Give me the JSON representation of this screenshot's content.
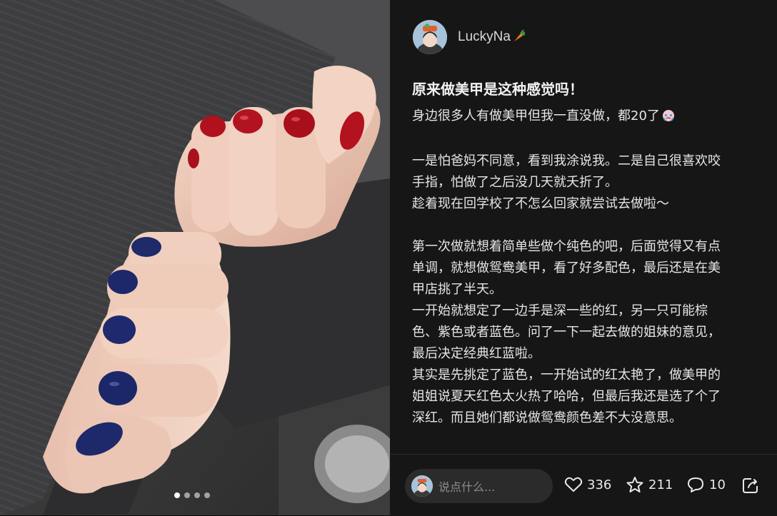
{
  "author": {
    "name": "LuckyNa",
    "name_suffix_icon": "carrot-emoji"
  },
  "post": {
    "title": "原来做美甲是这种感觉吗！",
    "lines": [
      "身边很多人有做美甲但我一直没做，都20了",
      "",
      "一是怕爸妈不同意，看到我涂说我。二是自己很喜欢咬",
      "手指，怕做了之后没几天就夭折了。",
      "趁着现在回学校了不怎么回家就尝试去做啦～",
      "",
      "第一次做就想着简单些做个纯色的吧，后面觉得又有点",
      "单调，就想做鸳鸯美甲，看了好多配色，最后还是在美",
      "甲店挑了半天。",
      "一开始就想定了一边手是深一些的红，另一只可能棕",
      "色、紫色或者蓝色。问了一下一起去做的姐妹的意见，",
      "最后决定经典红蓝啦。",
      "其实是先挑定了蓝色，一开始试的红太艳了，做美甲的",
      "姐姐说夏天红色太火热了哈哈，但最后我还是选了个了",
      "深红。而且她们都说做鸳鸯颜色差不大没意思。"
    ],
    "inline_emoji": "crying-face-emoji"
  },
  "gallery": {
    "total_images": 4,
    "current_index": 0
  },
  "bottom_bar": {
    "comment_placeholder": "说点什么...",
    "likes": "336",
    "stars": "211",
    "comments": "10",
    "icons": [
      "heart-icon",
      "star-icon",
      "comment-icon",
      "share-icon"
    ]
  },
  "colors": {
    "panel_bg": "#161616",
    "text": "#e6e6e6",
    "red_nail": "#b0111c",
    "blue_nail": "#1f2a6b"
  }
}
